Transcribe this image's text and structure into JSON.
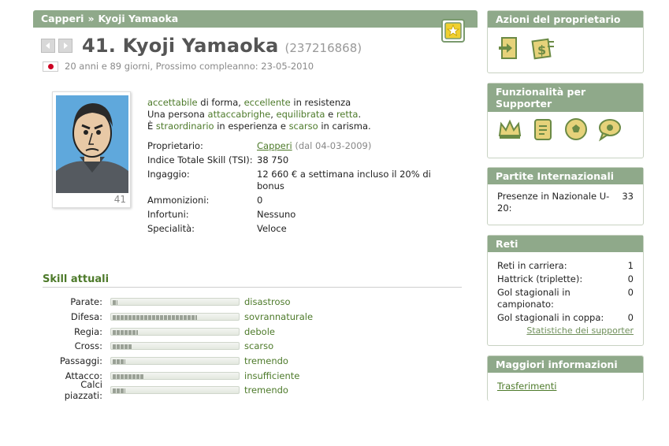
{
  "breadcrumb": {
    "team": "Capperi",
    "separator": "»",
    "player": "Kyoji Yamaoka"
  },
  "player": {
    "title": "41. Kyoji Yamaoka",
    "id": "(237216868)",
    "age_line": "20 anni e 89 giorni, Prossimo compleanno: 23-05-2010",
    "shirt_number": "41"
  },
  "description": {
    "line1": {
      "a": "accettabile",
      "b": " di forma, ",
      "c": "eccellente",
      "d": " in resistenza"
    },
    "line2": {
      "a": "Una persona ",
      "b": "attaccabrighe",
      "c": ", ",
      "d": "equilibrata",
      "e": " e ",
      "f": "retta",
      "g": "."
    },
    "line3": {
      "a": "È ",
      "b": "straordinario",
      "c": " in esperienza e ",
      "d": "scarso",
      "e": " in carisma."
    }
  },
  "info": {
    "owner_label": "Proprietario:",
    "owner_link": "Capperi",
    "owner_since": " (dal 04-03-2009)",
    "tsi_label": "Indice Totale Skill (TSI):",
    "tsi_value": "38 750",
    "wage_label": "Ingaggio:",
    "wage_value": "12 660 € a settimana incluso il 20% di bonus",
    "cards_label": "Ammonizioni:",
    "cards_value": "0",
    "injury_label": "Infortuni:",
    "injury_value": "Nessuno",
    "specialty_label": "Specialità:",
    "specialty_value": "Veloce"
  },
  "skills": {
    "title": "Skill attuali",
    "rows": [
      {
        "label": "Parate:",
        "level": "disastroso",
        "value": 0.04
      },
      {
        "label": "Difesa:",
        "level": "sovrannaturale",
        "value": 0.68
      },
      {
        "label": "Regia:",
        "level": "debole",
        "value": 0.2
      },
      {
        "label": "Cross:",
        "level": "scarso",
        "value": 0.16
      },
      {
        "label": "Passaggi:",
        "level": "tremendo",
        "value": 0.1
      },
      {
        "label": "Attacco:",
        "level": "insufficiente",
        "value": 0.25
      },
      {
        "label": "Calci piazzati:",
        "level": "tremendo",
        "value": 0.1
      }
    ]
  },
  "sidebar": {
    "owner_actions": {
      "title": "Azioni del proprietario",
      "icons": [
        "exit-door-icon",
        "money-transfer-icon"
      ]
    },
    "supporter": {
      "title": "Funzionalità per Supporter",
      "icons": [
        "crown-icon",
        "notes-icon",
        "ball-icon",
        "chat-bubble-icon"
      ]
    },
    "international": {
      "title": "Partite Internazionali",
      "label": "Presenze in Nazionale U-20:",
      "value": "33"
    },
    "goals": {
      "title": "Reti",
      "rows": [
        {
          "label": "Reti in carriera:",
          "value": "1"
        },
        {
          "label": "Hattrick (triplette):",
          "value": "0"
        },
        {
          "label": "Gol stagionali in campionato:",
          "value": "0"
        },
        {
          "label": "Gol stagionali in coppa:",
          "value": "0"
        }
      ],
      "link": "Statistiche dei supporter"
    },
    "more_info": {
      "title": "Maggiori informazioni",
      "link": "Trasferimenti"
    }
  },
  "colors": {
    "header_green": "#8fa98a",
    "text_green": "#4d7a2a",
    "skill_bar": "#9aa196"
  }
}
